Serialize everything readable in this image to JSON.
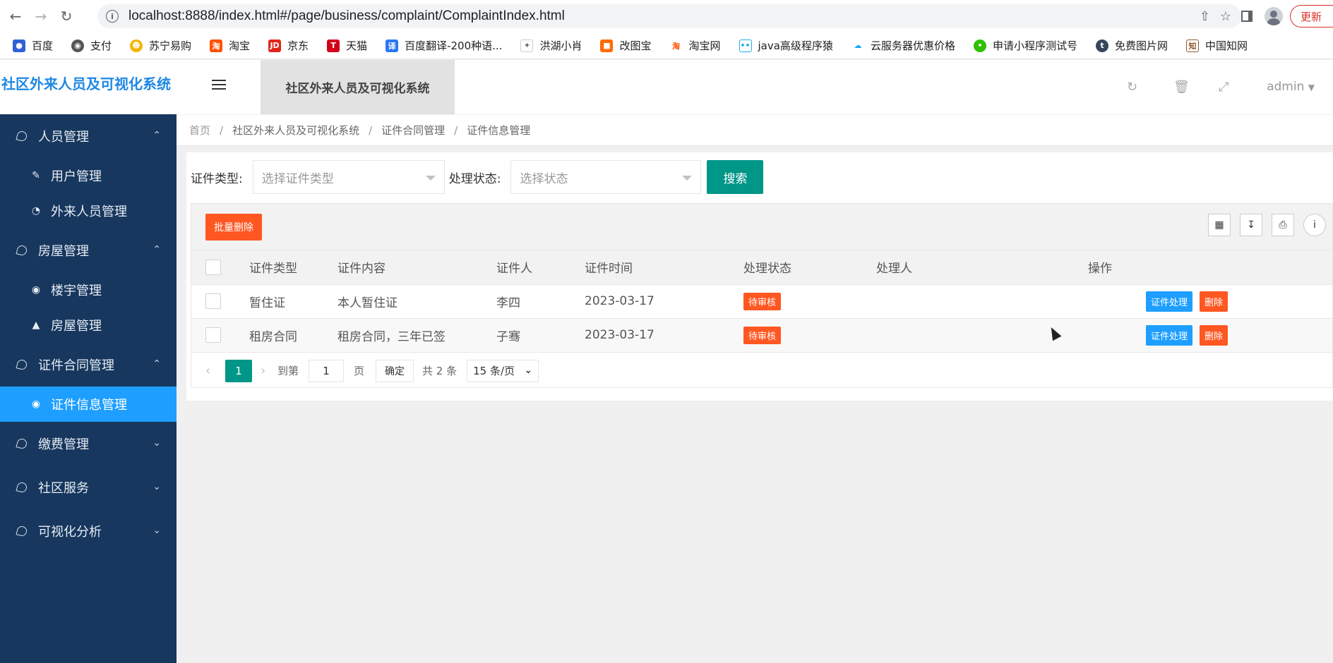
{
  "browser": {
    "url": "localhost:8888/index.html#/page/business/complaint/ComplaintIndex.html",
    "update_label": "更新"
  },
  "bookmarks": [
    {
      "label": "百度",
      "icon": "baidu-icon",
      "color": "#3060d8"
    },
    {
      "label": "支付",
      "icon": "globe-icon",
      "color": "#555555"
    },
    {
      "label": "苏宁易购",
      "icon": "suning-icon",
      "color": "#f5b400"
    },
    {
      "label": "淘宝",
      "icon": "taobao-icon",
      "color": "#ff5000"
    },
    {
      "label": "京东",
      "icon": "jd-icon",
      "color": "#e1251b"
    },
    {
      "label": "天猫",
      "icon": "tmall-icon",
      "color": "#d4001a"
    },
    {
      "label": "百度翻译-200种语...",
      "icon": "translate-icon",
      "color": "#2b77f5"
    },
    {
      "label": "洪湖小肖",
      "icon": "bird-icon",
      "color": "#666666"
    },
    {
      "label": "改图宝",
      "icon": "gaitubao-icon",
      "color": "#ff6a00"
    },
    {
      "label": "淘宝网",
      "icon": "taobao-icon",
      "color": "#ff5000"
    },
    {
      "label": "java高级程序猿",
      "icon": "bilibili-icon",
      "color": "#23ade5"
    },
    {
      "label": "云服务器优惠价格",
      "icon": "cloud-icon",
      "color": "#1aa3ff"
    },
    {
      "label": "申请小程序测试号",
      "icon": "wechat-icon",
      "color": "#2dc100"
    },
    {
      "label": "免费图片网",
      "icon": "tumblr-icon",
      "color": "#35465c"
    },
    {
      "label": "中国知网",
      "icon": "cnki-icon",
      "color": "#8b5a2b"
    }
  ],
  "app": {
    "logo": "社区外来人员及可视化系统",
    "tab_title": "社区外来人员及可视化系统",
    "user": "admin"
  },
  "sidebar": {
    "groups": [
      {
        "label": "人员管理",
        "expanded": true,
        "items": [
          {
            "label": "用户管理",
            "icon": "edit-icon"
          },
          {
            "label": "外来人员管理",
            "icon": "dashboard-icon"
          }
        ]
      },
      {
        "label": "房屋管理",
        "expanded": true,
        "items": [
          {
            "label": "楼宇管理",
            "icon": "radio-icon"
          },
          {
            "label": "房屋管理",
            "icon": "chevron-circle-icon"
          }
        ]
      },
      {
        "label": "证件合同管理",
        "expanded": true,
        "items": [
          {
            "label": "证件信息管理",
            "icon": "radio-icon",
            "active": true
          }
        ]
      },
      {
        "label": "缴费管理",
        "expanded": false
      },
      {
        "label": "社区服务",
        "expanded": false
      },
      {
        "label": "可视化分析",
        "expanded": false
      }
    ]
  },
  "breadcrumb": [
    "首页",
    "社区外来人员及可视化系统",
    "证件合同管理",
    "证件信息管理"
  ],
  "search": {
    "type_label": "证件类型:",
    "type_placeholder": "选择证件类型",
    "status_label": "处理状态:",
    "status_placeholder": "选择状态",
    "button": "搜索"
  },
  "toolbar": {
    "batch_delete": "批量删除"
  },
  "table": {
    "columns": [
      "证件类型",
      "证件内容",
      "证件人",
      "证件时间",
      "处理状态",
      "处理人",
      "操作"
    ],
    "rows": [
      {
        "type": "暂住证",
        "content": "本人暂住证",
        "person": "李四",
        "time": "2023-03-17",
        "status": "待审核",
        "handler": ""
      },
      {
        "type": "租房合同",
        "content": "租房合同，三年已签",
        "person": "子骞",
        "time": "2023-03-17",
        "status": "待审核",
        "handler": ""
      }
    ],
    "action_handle": "证件处理",
    "action_delete": "删除"
  },
  "pager": {
    "current": "1",
    "goto_label": "到第",
    "goto_value": "1",
    "page_unit": "页",
    "confirm": "确定",
    "total": "共 2 条",
    "page_size": "15 条/页"
  }
}
